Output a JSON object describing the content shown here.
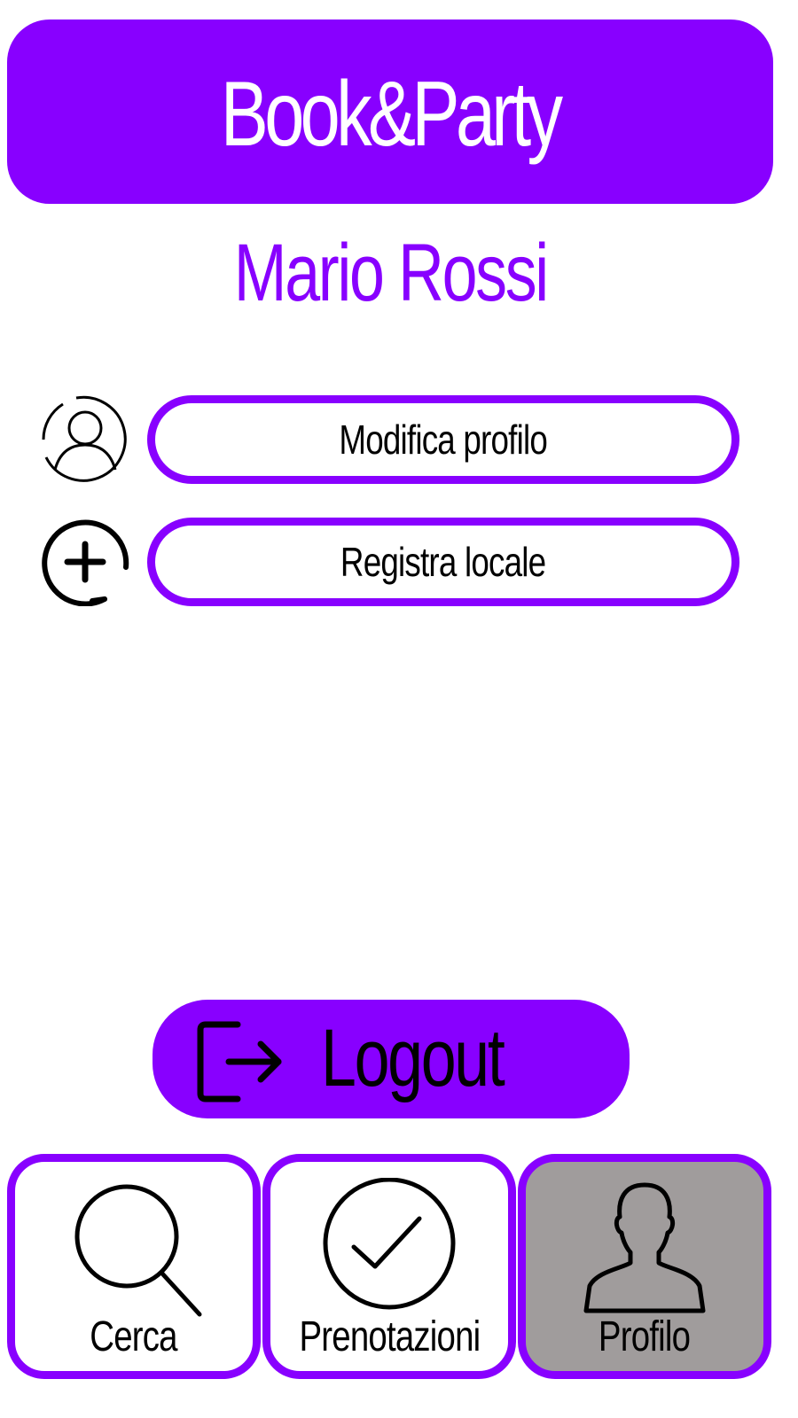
{
  "app": {
    "title": "Book&Party"
  },
  "profile": {
    "name": "Mario Rossi"
  },
  "actions": [
    {
      "label": "Modifica profilo",
      "icon": "user-profile-icon"
    },
    {
      "label": "Registra locale",
      "icon": "add-circle-icon"
    }
  ],
  "logout": {
    "label": "Logout",
    "icon": "logout-icon"
  },
  "nav": {
    "tabs": [
      {
        "label": "Cerca",
        "icon": "search-icon",
        "active": false
      },
      {
        "label": "Prenotazioni",
        "icon": "check-circle-icon",
        "active": false
      },
      {
        "label": "Profilo",
        "icon": "person-silhouette-icon",
        "active": true
      }
    ]
  },
  "colors": {
    "accent": "#8800ff",
    "active_tab": "#a09c9c",
    "background": "#ffffff"
  }
}
